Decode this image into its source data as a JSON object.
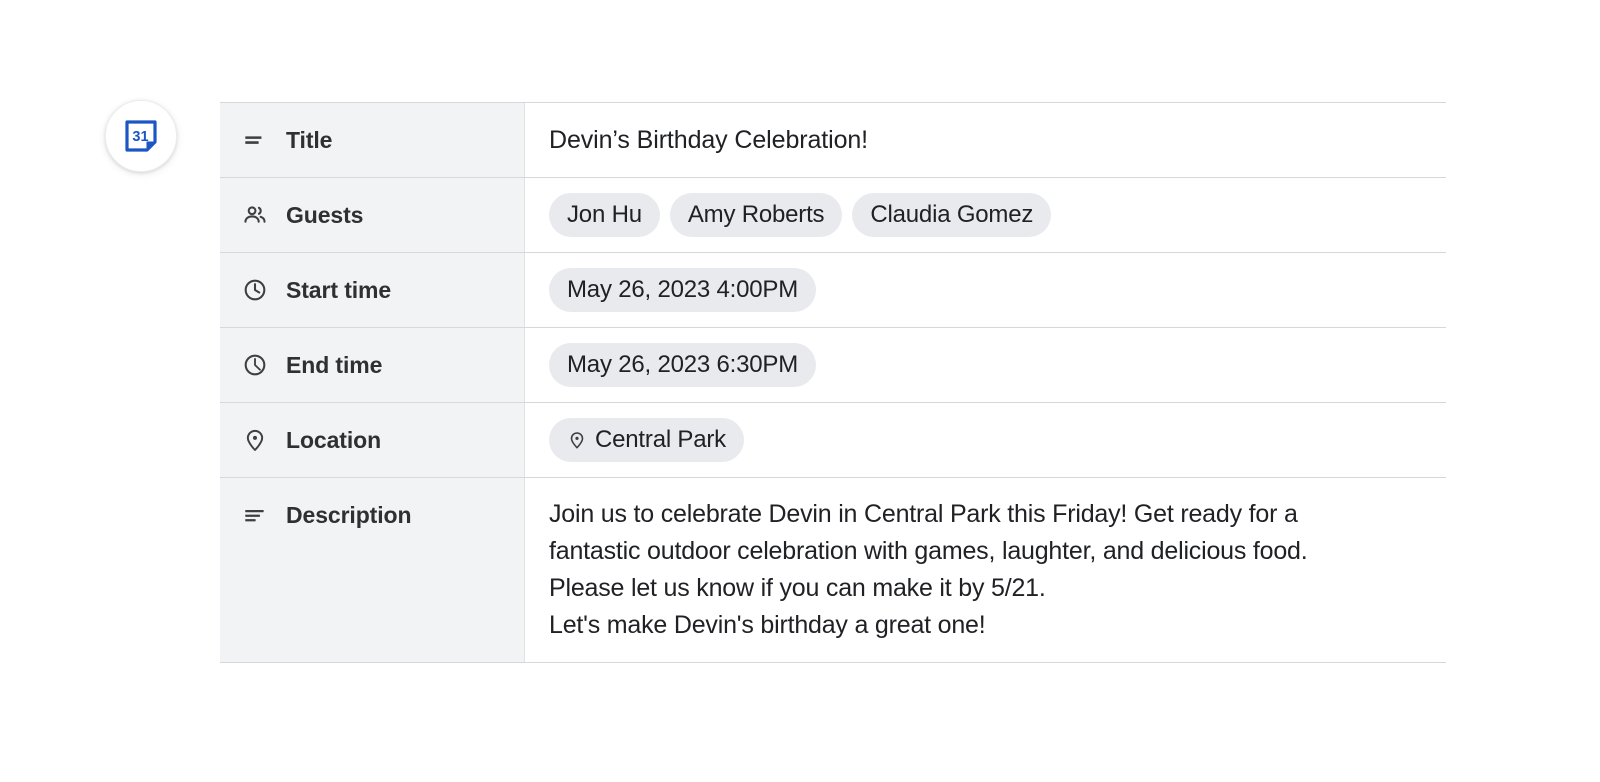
{
  "badge": {
    "icon": "google-calendar-icon",
    "day_number": "31",
    "color": "#1a73e8"
  },
  "theme": {
    "label_bg": "#f1f3f4",
    "chip_bg": "#e8eaed",
    "text": "#202124",
    "border": "#d6d9dc"
  },
  "rows": [
    {
      "key": "title",
      "icon": "title-lines-icon",
      "label": "Title",
      "value": "Devin’s Birthday Celebration!"
    },
    {
      "key": "guests",
      "icon": "people-icon",
      "label": "Guests",
      "chips": [
        "Jon Hu",
        "Amy Roberts",
        "Claudia Gomez"
      ]
    },
    {
      "key": "start_time",
      "icon": "clock-icon",
      "label": "Start time",
      "chips": [
        "May 26, 2023 4:00PM"
      ]
    },
    {
      "key": "end_time",
      "icon": "clock-end-icon",
      "label": "End time",
      "chips": [
        "May 26, 2023 6:30PM"
      ]
    },
    {
      "key": "location",
      "icon": "map-pin-icon",
      "label": "Location",
      "chip_icon": "map-pin-icon",
      "chips": [
        "Central Park"
      ]
    },
    {
      "key": "description",
      "icon": "notes-icon",
      "label": "Description",
      "lines": [
        "Join us to celebrate Devin in Central Park this Friday! Get ready for a fantastic outdoor celebration with games, laughter, and delicious food. Please let us know if you can make it by 5/21.",
        "Let's make Devin's birthday a great one!"
      ]
    }
  ]
}
